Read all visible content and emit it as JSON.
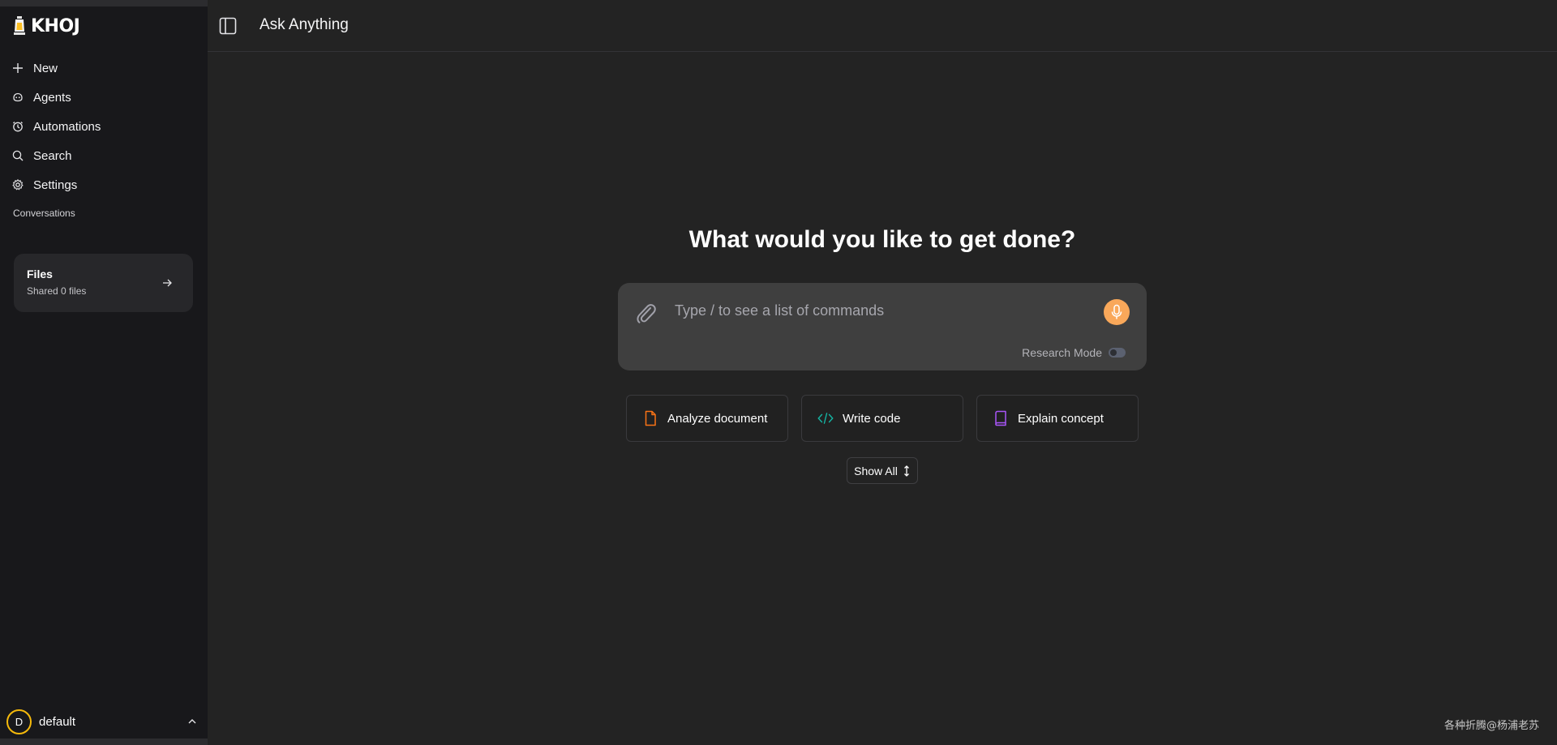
{
  "brand": {
    "name": "KHOJ"
  },
  "header": {
    "title": "Ask Anything"
  },
  "sidebar": {
    "items": [
      {
        "label": "New",
        "icon": "plus-icon"
      },
      {
        "label": "Agents",
        "icon": "agent-icon"
      },
      {
        "label": "Automations",
        "icon": "automation-icon"
      },
      {
        "label": "Search",
        "icon": "search-icon"
      },
      {
        "label": "Settings",
        "icon": "gear-icon"
      }
    ],
    "section_label": "Conversations",
    "files_card": {
      "title": "Files",
      "subtitle": "Shared 0 files"
    },
    "user": {
      "initial": "D",
      "name": "default"
    }
  },
  "main": {
    "headline": "What would you like to get done?",
    "input": {
      "placeholder": "Type / to see a list of commands",
      "value": ""
    },
    "research_mode": {
      "label": "Research Mode",
      "enabled": false
    },
    "suggestions": [
      {
        "label": "Analyze document",
        "icon": "document-icon",
        "color": "#f97316"
      },
      {
        "label": "Write code",
        "icon": "code-icon",
        "color": "#14b8a6"
      },
      {
        "label": "Explain concept",
        "icon": "book-icon",
        "color": "#a855f7"
      }
    ],
    "show_all_label": "Show All"
  },
  "colors": {
    "accent_mic": "#f9a85a",
    "avatar_ring": "#f5b90b"
  },
  "watermark": "各种折腾@杨浦老苏"
}
